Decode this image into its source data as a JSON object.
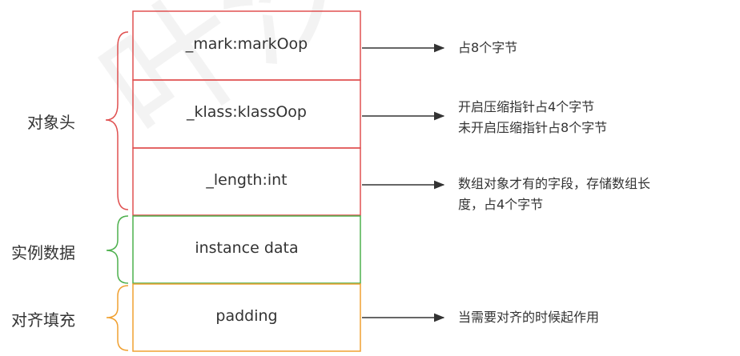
{
  "fields": [
    {
      "key": "mark",
      "label": "_mark:markOop"
    },
    {
      "key": "klass",
      "label": "_klass:klassOop"
    },
    {
      "key": "length",
      "label": "_length:int"
    },
    {
      "key": "instance",
      "label": "instance data"
    },
    {
      "key": "padding",
      "label": "padding"
    }
  ],
  "groups": {
    "header": "对象头",
    "instance": "实例数据",
    "padding": "对齐填充"
  },
  "notes": {
    "mark": "占8个字节",
    "klass_line1": "开启压缩指针占4个字节",
    "klass_line2": "未开启压缩指针占8个字节",
    "length_line1": "数组对象才有的字段，存储数组长",
    "length_line2": "度，占4个字节",
    "padding": "当需要对齐的时候起作用"
  },
  "colors": {
    "header": "#e05050",
    "instance": "#4db04d",
    "padding": "#f0a030",
    "arrow": "#333333",
    "text": "#333333"
  }
}
